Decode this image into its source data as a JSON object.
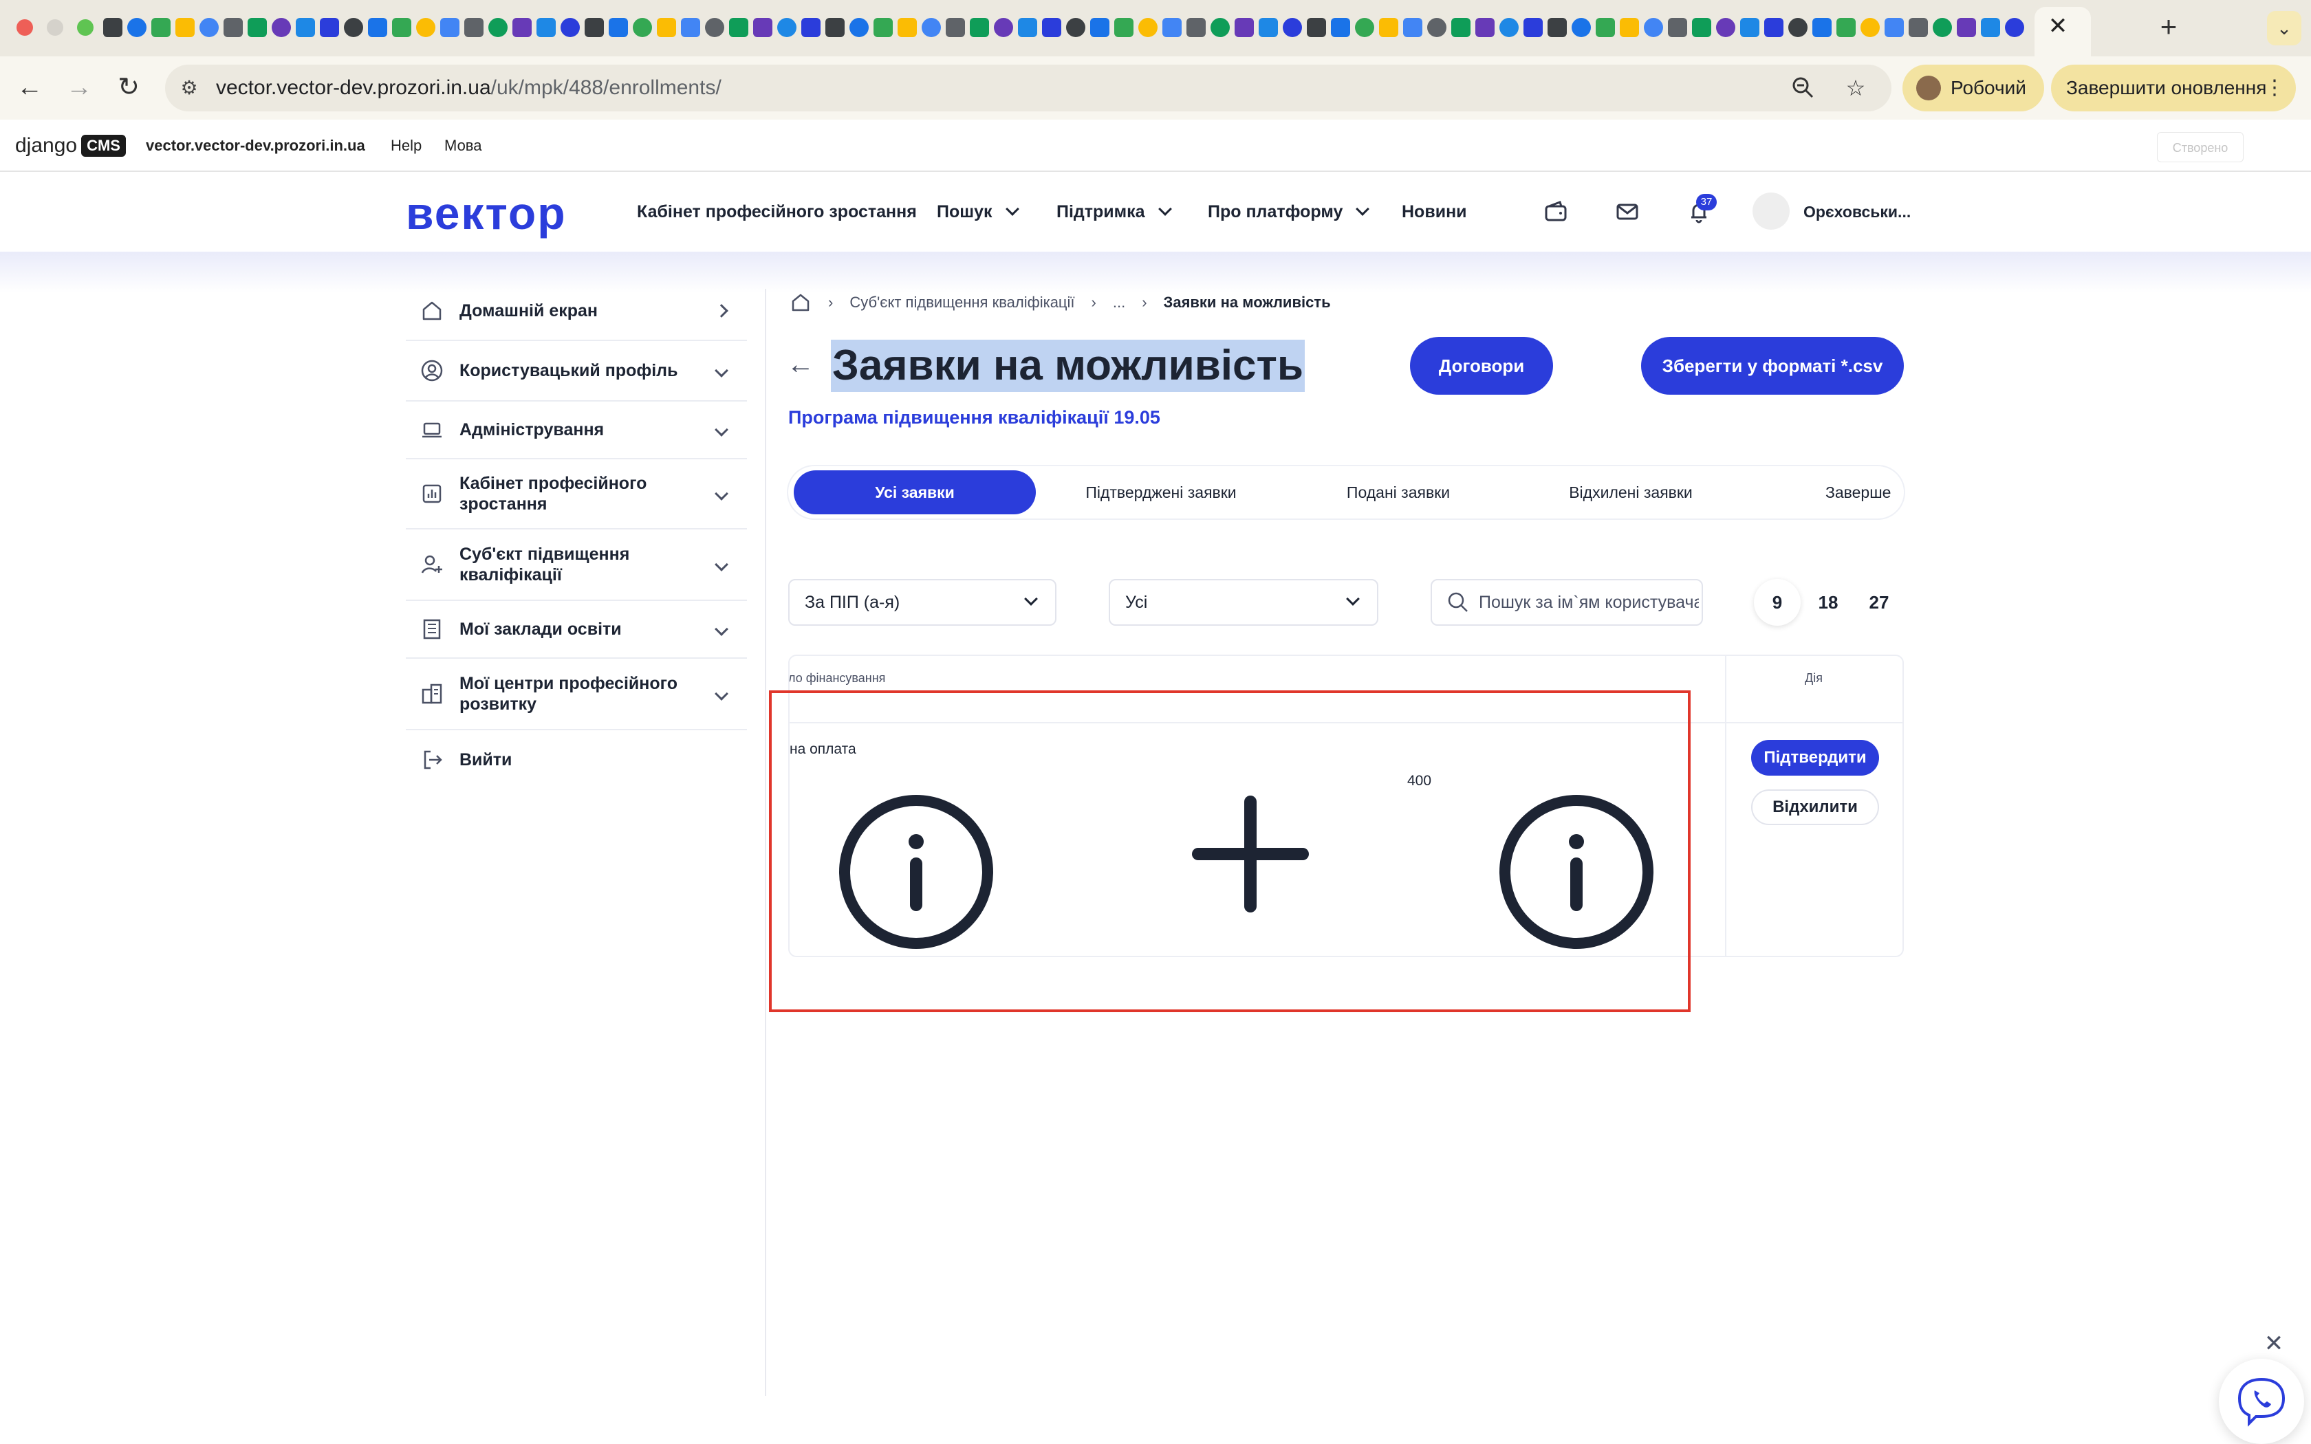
{
  "browser": {
    "url_host": "vector.vector-dev.prozori.in.ua",
    "url_path": "/uk/mpk/488/enrollments/",
    "profile_label": "Робочий",
    "update_label": "Завершити оновлення",
    "close_tab": "✕",
    "new_tab": "+",
    "tab_menu": "⌄"
  },
  "cms": {
    "logo_django": "django",
    "logo_cms": "CMS",
    "site": "vector.vector-dev.prozori.in.ua",
    "help": "Help",
    "language": "Мова",
    "status": "Створено"
  },
  "header": {
    "logo": "вектор",
    "nav": [
      "Кабінет професійного зростання",
      "Пошук",
      "Підтримка",
      "Про платформу",
      "Новини"
    ],
    "notifications_count": "37",
    "user_name": "Орєховськи..."
  },
  "sidebar": {
    "items": [
      {
        "label": "Домашній екран",
        "icon": "home-icon"
      },
      {
        "label": "Користувацький профіль",
        "icon": "user-circle-icon"
      },
      {
        "label": "Адміністрування",
        "icon": "laptop-icon"
      },
      {
        "label": "Кабінет професійного зростання",
        "icon": "chart-icon"
      },
      {
        "label": "Суб'єкт підвищення кваліфікації",
        "icon": "user-add-icon"
      },
      {
        "label": "Мої заклади освіти",
        "icon": "building-icon"
      },
      {
        "label": "Мої центри професійного розвитку",
        "icon": "office-icon"
      },
      {
        "label": "Вийти",
        "icon": "logout-icon"
      }
    ]
  },
  "breadcrumb": {
    "items": [
      "Суб'єкт підвищення кваліфікації",
      "...",
      "Заявки на можливість"
    ]
  },
  "page": {
    "title": "Заявки на можливість",
    "subtitle": "Програма підвищення кваліфікації 19.05",
    "contracts_button": "Договори",
    "csv_button": "Зберегти у форматі *.csv"
  },
  "tabs": [
    "Усі заявки",
    "Підтверджені заявки",
    "Подані заявки",
    "Відхилені заявки",
    "Заверше"
  ],
  "filters": {
    "sort": "За ПІП (а-я)",
    "status": "Усі",
    "search_placeholder": "Пошук за ім`ям користувача",
    "page_sizes": [
      "9",
      "18",
      "27"
    ]
  },
  "table": {
    "headers": {
      "funding": "ло фінансування",
      "action": "Дія"
    },
    "row": {
      "funding": "на оплата",
      "amount": "400",
      "confirm": "Підтвердити",
      "reject": "Відхилити"
    }
  },
  "colors": {
    "brand": "#2b3ddb",
    "highlight_frame": "#e0362b",
    "text": "#1d2433"
  }
}
